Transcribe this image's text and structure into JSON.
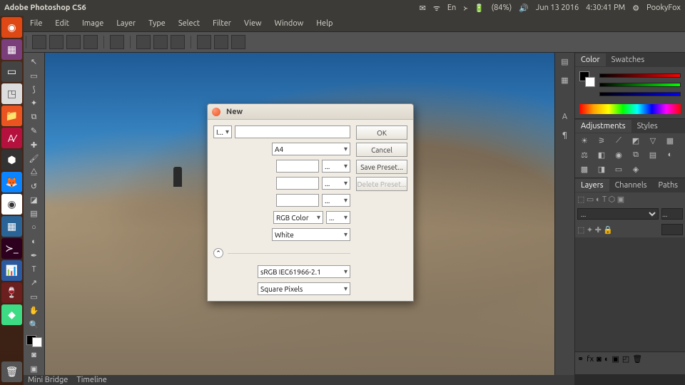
{
  "topbar": {
    "title": "Adobe Photoshop CS6",
    "lang": "En",
    "battery": "(84%)",
    "date": "Jun 13 2016",
    "time": "4:30:41 PM",
    "user": "PookyFox"
  },
  "menus": [
    "File",
    "Edit",
    "Image",
    "Layer",
    "Type",
    "Select",
    "Filter",
    "View",
    "Window",
    "Help"
  ],
  "panels": {
    "color": {
      "tabs": [
        "Color",
        "Swatches"
      ],
      "active": 0
    },
    "adjust": {
      "tabs": [
        "Adjustments",
        "Styles"
      ],
      "active": 0
    },
    "layers": {
      "tabs": [
        "Layers",
        "Channels",
        "Paths"
      ],
      "active": 0,
      "mode": "...",
      "opacity": "..."
    }
  },
  "footer": {
    "tabs": [
      "Mini Bridge",
      "Timeline"
    ]
  },
  "dialog": {
    "title": "New",
    "name": "",
    "name_label": "I...",
    "preset": "A4",
    "width": "",
    "width_u": "...",
    "height": "",
    "height_u": "...",
    "res": "",
    "res_u": "...",
    "color_mode": "RGB Color",
    "color_bits": "...",
    "bg": "White",
    "profile": "sRGB IEC61966-2.1",
    "pixel_aspect": "Square Pixels",
    "ok": "OK",
    "cancel": "Cancel",
    "save": "Save Preset...",
    "del": "Delete Preset..."
  },
  "colors": {
    "accent": "#e95420",
    "panel_bg": "#454545"
  }
}
